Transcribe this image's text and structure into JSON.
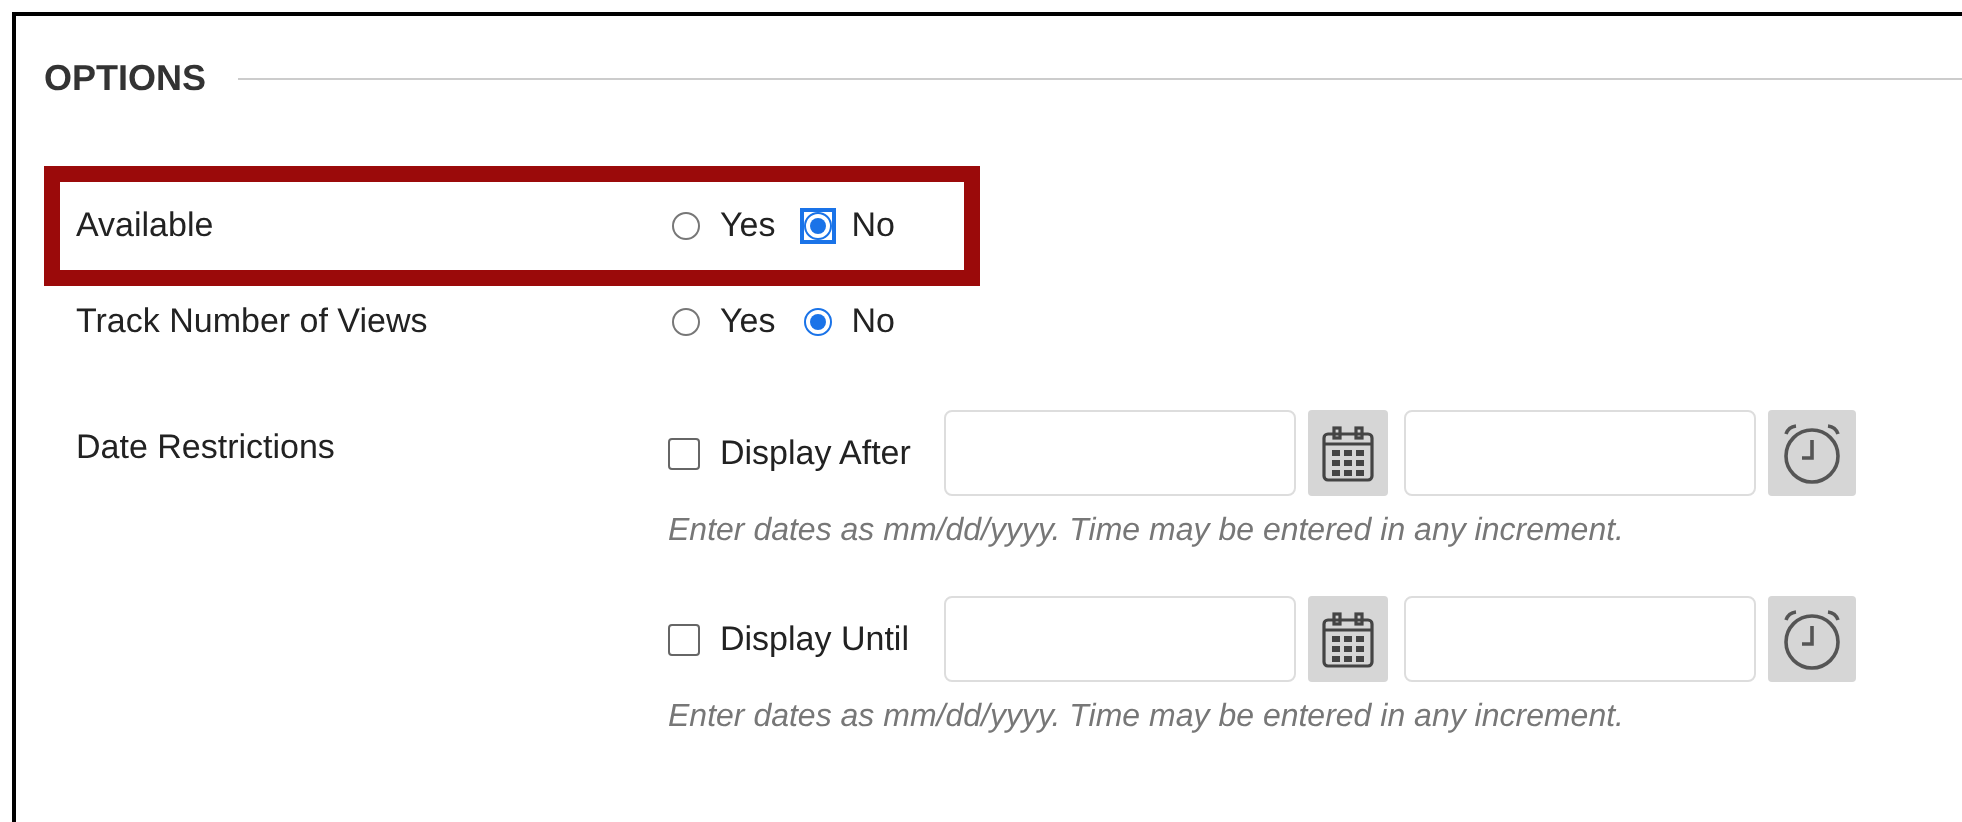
{
  "section": {
    "title": "OPTIONS"
  },
  "radio_rows": [
    {
      "label": "Available",
      "highlighted": true,
      "options": [
        {
          "label": "Yes",
          "selected": false,
          "focused": false
        },
        {
          "label": "No",
          "selected": true,
          "focused": true
        }
      ]
    },
    {
      "label": "Track Number of Views",
      "highlighted": false,
      "options": [
        {
          "label": "Yes",
          "selected": false,
          "focused": false
        },
        {
          "label": "No",
          "selected": true,
          "focused": false
        }
      ]
    }
  ],
  "date_restrictions": {
    "label": "Date Restrictions",
    "items": [
      {
        "label": "Display After",
        "checked": false,
        "hint": "Enter dates as mm/dd/yyyy. Time may be entered in any increment."
      },
      {
        "label": "Display Until",
        "checked": false,
        "hint": "Enter dates as mm/dd/yyyy. Time may be entered in any increment."
      }
    ]
  }
}
